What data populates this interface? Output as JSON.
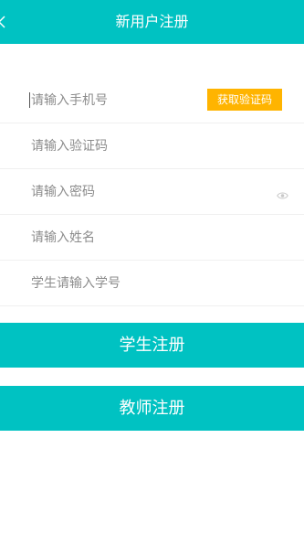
{
  "header": {
    "title": "新用户注册",
    "back_icon": "chevron-left-icon"
  },
  "form": {
    "phone": {
      "placeholder": "请输入手机号",
      "value": ""
    },
    "get_code_label": "获取验证码",
    "code": {
      "placeholder": "请输入验证码",
      "value": ""
    },
    "password": {
      "placeholder": "请输入密码",
      "value": "",
      "toggle_icon": "eye-icon"
    },
    "name": {
      "placeholder": "请输入姓名",
      "value": ""
    },
    "student_id": {
      "placeholder": "学生请输入学号",
      "value": ""
    }
  },
  "buttons": {
    "student_register": "学生注册",
    "teacher_register": "教师注册"
  },
  "colors": {
    "primary": "#00C2C2",
    "accent": "#FFB400",
    "placeholder": "#8c8c8c",
    "divider": "#f0f0f0"
  }
}
